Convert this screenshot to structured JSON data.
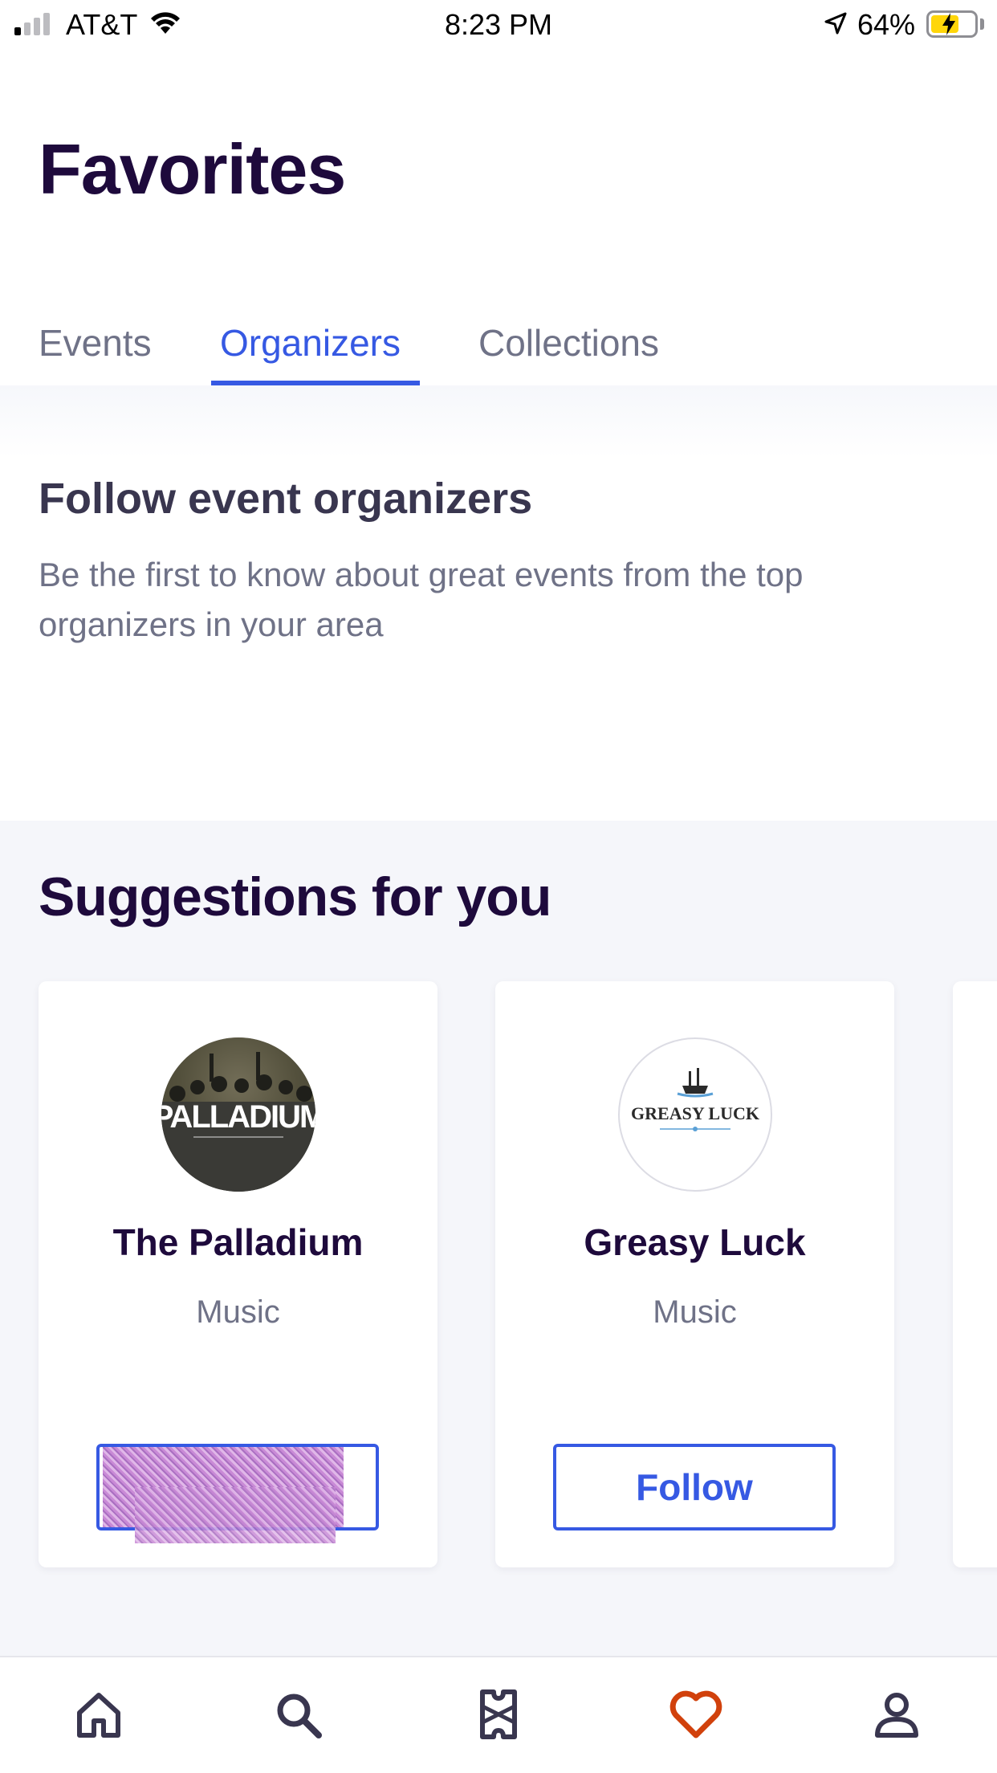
{
  "status_bar": {
    "carrier": "AT&T",
    "time": "8:23 PM",
    "battery": "64%"
  },
  "header": {
    "title": "Favorites"
  },
  "tabs": [
    {
      "label": "Events",
      "active": false
    },
    {
      "label": "Organizers",
      "active": true
    },
    {
      "label": "Collections",
      "active": false
    }
  ],
  "follow_section": {
    "title": "Follow event organizers",
    "description": "Be the first to know about great events from the top organizers in your area"
  },
  "suggestions": {
    "title": "Suggestions for you",
    "cards": [
      {
        "name": "The Palladium",
        "category": "Music",
        "logo_text": "PALLADIUM",
        "button_label": ""
      },
      {
        "name": "Greasy Luck",
        "category": "Music",
        "logo_text": "GREASY LUCK",
        "button_label": "Follow"
      }
    ]
  },
  "bottom_nav": [
    {
      "icon": "home-icon"
    },
    {
      "icon": "search-icon"
    },
    {
      "icon": "tickets-icon"
    },
    {
      "icon": "heart-icon",
      "active": true
    },
    {
      "icon": "profile-icon"
    }
  ],
  "colors": {
    "accent": "#3659e3",
    "title": "#1e0a3c",
    "muted": "#6f7287",
    "heart": "#d1410c"
  }
}
